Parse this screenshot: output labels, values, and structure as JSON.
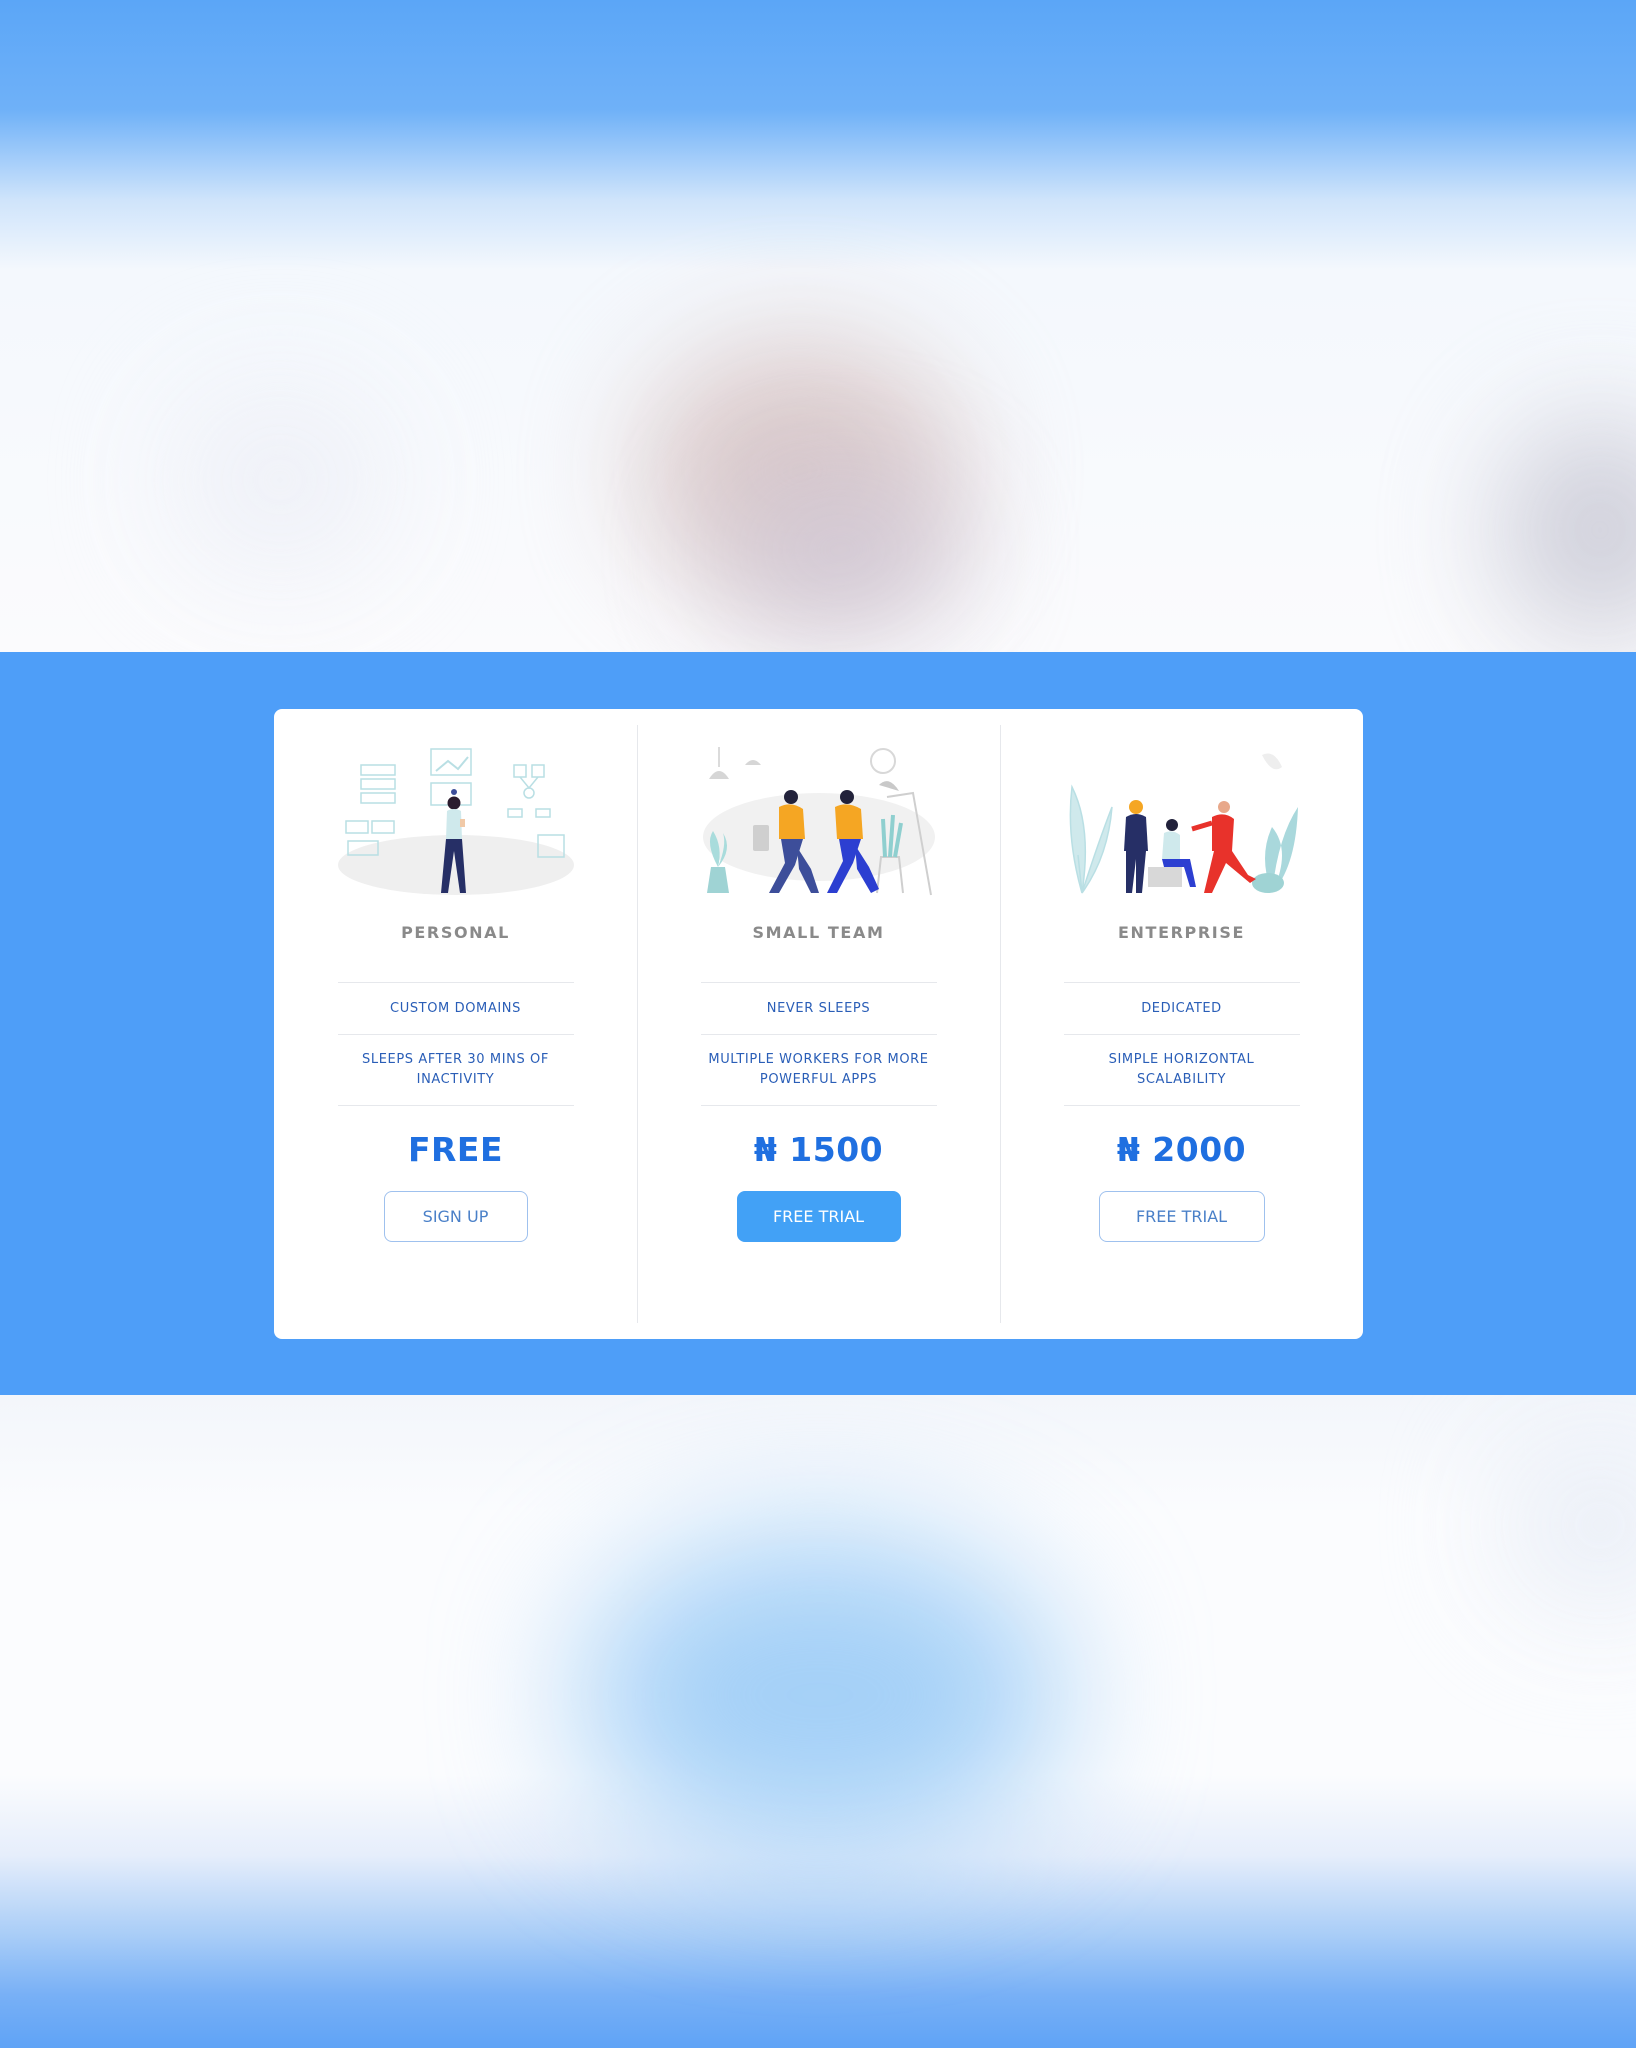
{
  "plans": [
    {
      "name": "PERSONAL",
      "features": [
        "CUSTOM DOMAINS",
        "SLEEPS AFTER 30 MINS OF INACTIVITY"
      ],
      "price": "FREE",
      "button": "SIGN UP",
      "illustration": "person-with-dashboard-illustration"
    },
    {
      "name": "SMALL TEAM",
      "features": [
        "NEVER SLEEPS",
        "MULTIPLE WORKERS FOR MORE POWERFUL APPS"
      ],
      "price": "₦ 1500",
      "button": "FREE TRIAL",
      "illustration": "two-people-walking-illustration"
    },
    {
      "name": "ENTERPRISE",
      "features": [
        "DEDICATED",
        "SIMPLE HORIZONTAL SCALABILITY"
      ],
      "price": "₦ 2000",
      "button": "FREE TRIAL",
      "illustration": "team-meeting-illustration"
    }
  ],
  "colors": {
    "band": "#4e9ef8",
    "price": "#1f6fe0",
    "feature_text": "#2a5eb7",
    "primary_button": "#42a1f6"
  }
}
